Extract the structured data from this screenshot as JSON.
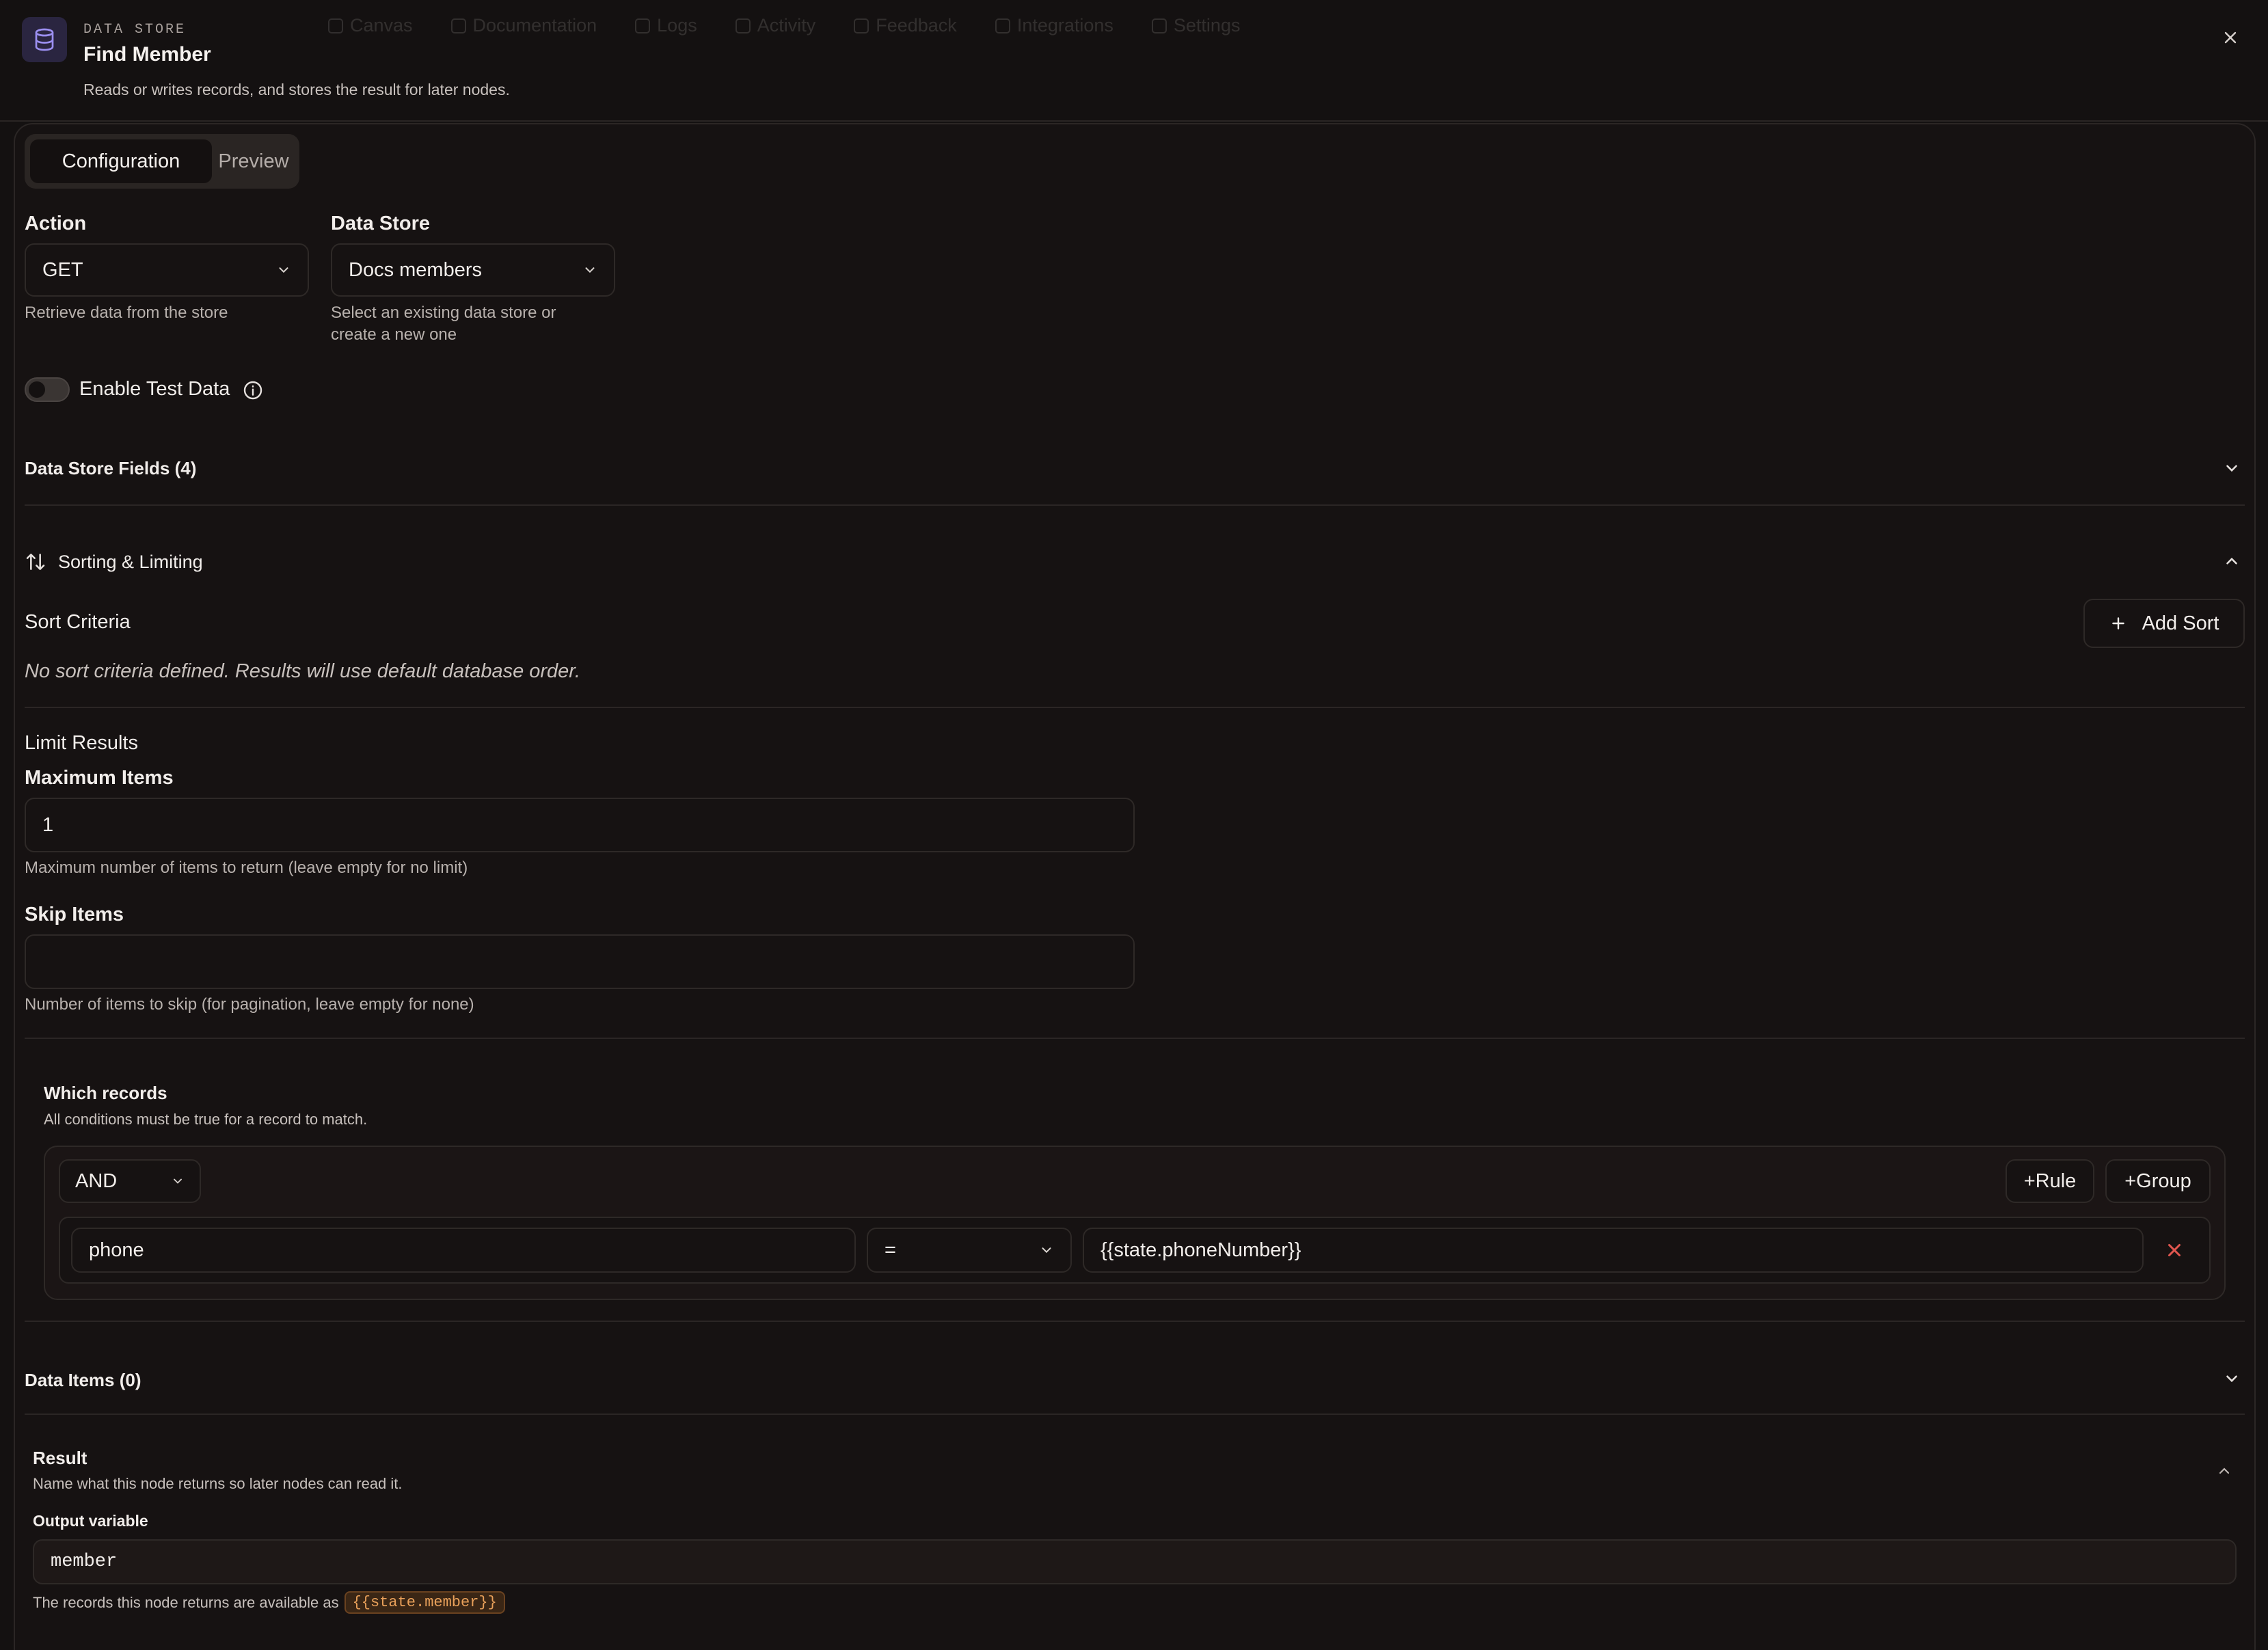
{
  "background_nav": [
    "Canvas",
    "Documentation",
    "Logs",
    "Activity",
    "Feedback",
    "Integrations",
    "Settings"
  ],
  "header": {
    "eyebrow": "DATA STORE",
    "title": "Find Member",
    "subtitle": "Reads or writes records, and stores the result for later nodes.",
    "icon": "database-icon"
  },
  "tabs": [
    {
      "label": "Configuration",
      "active": true
    },
    {
      "label": "Preview",
      "active": false
    }
  ],
  "action": {
    "label": "Action",
    "value": "GET",
    "help": "Retrieve data from the store"
  },
  "data_store": {
    "label": "Data Store",
    "value": "Docs members",
    "help_line1": "Select an existing data store or",
    "help_line2": "create a new one"
  },
  "test_data": {
    "label": "Enable Test Data",
    "enabled": false
  },
  "fields_section": {
    "title": "Data Store Fields (4)",
    "expanded": false
  },
  "sorting": {
    "title": "Sorting & Limiting",
    "expanded": true,
    "sort_criteria_label": "Sort Criteria",
    "add_sort_label": "Add Sort",
    "empty_text": "No sort criteria defined. Results will use default database order."
  },
  "limit": {
    "title": "Limit Results",
    "max_label": "Maximum Items",
    "max_value": "1",
    "max_help": "Maximum number of items to return (leave empty for no limit)",
    "skip_label": "Skip Items",
    "skip_value": "",
    "skip_help": "Number of items to skip (for pagination, leave empty for none)"
  },
  "records": {
    "title": "Which records",
    "subtitle": "All conditions must be true for a record to match.",
    "combinator": "AND",
    "add_rule_label": "+Rule",
    "add_group_label": "+Group",
    "rule": {
      "field": "phone",
      "operator": "=",
      "value": "{{state.phoneNumber}}"
    }
  },
  "data_items": {
    "title": "Data Items (0)",
    "expanded": false
  },
  "result": {
    "title": "Result",
    "subtitle": "Name what this node returns so later nodes can read it.",
    "output_label": "Output variable",
    "output_value": "member",
    "note": "The records this node returns are available as",
    "token": "{{state.member}}"
  },
  "colors": {
    "accent_purple": "#8f84e8",
    "remove_red": "#e0564f",
    "token_orange": "#e8a05a"
  }
}
